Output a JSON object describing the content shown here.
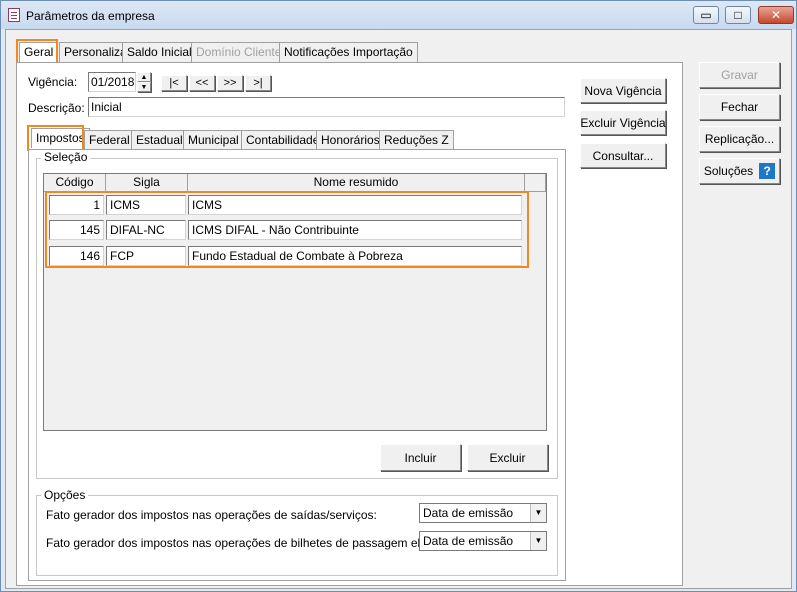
{
  "window": {
    "title": "Parâmetros da empresa",
    "controls": {
      "minimize": "▭",
      "maximize": "□",
      "close": "✕"
    }
  },
  "main_tabs": [
    {
      "label": "Geral",
      "active": true
    },
    {
      "label": "Personaliza"
    },
    {
      "label": "Saldo Inicial"
    },
    {
      "label": "Domínio Cliente",
      "disabled": true
    },
    {
      "label": "Notificações Importação"
    }
  ],
  "vigencia": {
    "label": "Vigência:",
    "value": "01/2018",
    "nav": [
      "|<",
      "<<",
      ">>",
      ">|"
    ]
  },
  "descricao": {
    "label": "Descrição:",
    "value": "Inicial"
  },
  "sub_tabs": [
    {
      "label": "Impostos",
      "active": true
    },
    {
      "label": "Federal"
    },
    {
      "label": "Estadual"
    },
    {
      "label": "Municipal"
    },
    {
      "label": "Contabilidade"
    },
    {
      "label": "Honorários"
    },
    {
      "label": "Reduções Z"
    }
  ],
  "selecao": {
    "title": "Seleção",
    "columns": [
      "Código",
      "Sigla",
      "Nome resumido"
    ],
    "rows": [
      {
        "codigo": "1",
        "sigla": "ICMS",
        "nome": "ICMS"
      },
      {
        "codigo": "145",
        "sigla": "DIFAL-NC",
        "nome": "ICMS DIFAL - Não Contribuinte"
      },
      {
        "codigo": "146",
        "sigla": "FCP",
        "nome": "Fundo Estadual de Combate à Pobreza"
      }
    ],
    "incluir": "Incluir",
    "excluir": "Excluir"
  },
  "opcoes": {
    "title": "Opções",
    "items": [
      {
        "label": "Fato gerador dos impostos nas operações de saídas/serviços:",
        "value": "Data de emissão"
      },
      {
        "label": "Fato gerador dos impostos nas operações de bilhetes de passagem eletrônico:",
        "value": "Data de emissão"
      }
    ]
  },
  "vigencia_buttons": {
    "nova": "Nova Vigência",
    "excluir": "Excluir Vigência",
    "consultar": "Consultar..."
  },
  "right_buttons": {
    "gravar": "Gravar",
    "fechar": "Fechar",
    "replicacao": "Replicação...",
    "solucoes": "Soluções",
    "help_glyph": "?"
  },
  "colors": {
    "highlight": "#f0891e",
    "help_icon": "#1e78c8"
  }
}
